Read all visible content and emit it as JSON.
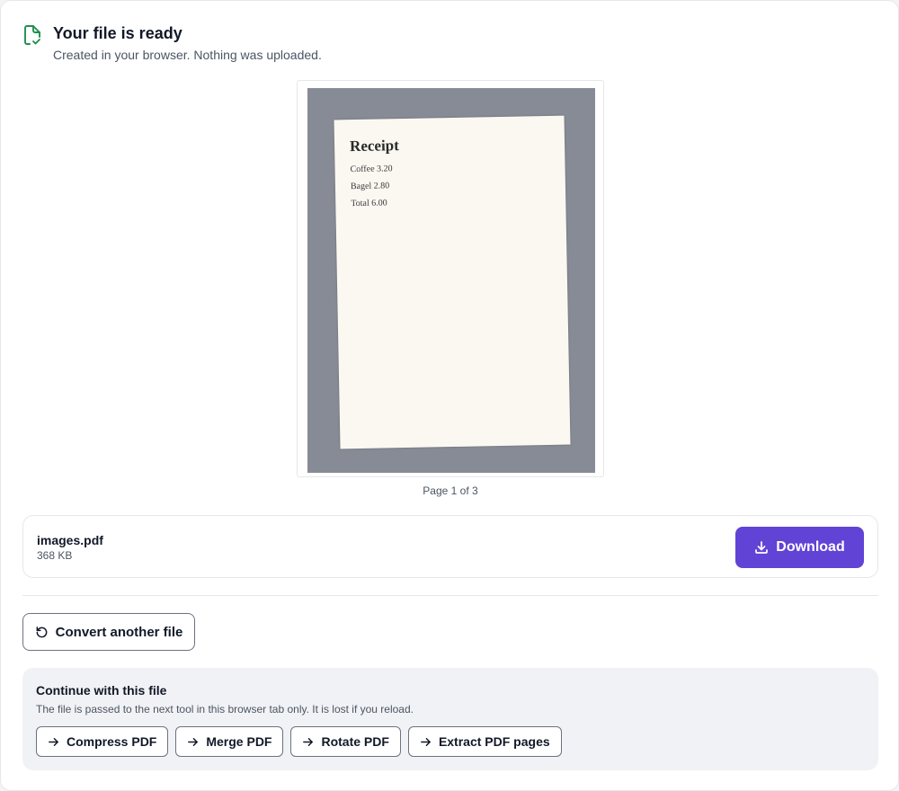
{
  "header": {
    "icon": "file-check-icon",
    "title": "Your file is ready",
    "subtitle": "Created in your browser. Nothing was uploaded."
  },
  "preview": {
    "document_title": "Receipt",
    "document_lines": [
      "Coffee 3.20",
      "Bagel 2.80",
      "Total 6.00"
    ],
    "page_indicator": "Page 1 of 3"
  },
  "file": {
    "name": "images.pdf",
    "size": "368 KB",
    "download_label": "Download",
    "download_icon": "download-icon"
  },
  "actions": {
    "convert_another_label": "Convert another file",
    "convert_another_icon": "rotate-ccw-icon"
  },
  "continue": {
    "title": "Continue with this file",
    "note": "The file is passed to the next tool in this browser tab only. It is lost if you reload.",
    "tools": [
      {
        "label": "Compress PDF",
        "icon": "arrow-right-icon"
      },
      {
        "label": "Merge PDF",
        "icon": "arrow-right-icon"
      },
      {
        "label": "Rotate PDF",
        "icon": "arrow-right-icon"
      },
      {
        "label": "Extract PDF pages",
        "icon": "arrow-right-icon"
      }
    ]
  },
  "colors": {
    "accent": "#6143d6",
    "success": "#1f8f4e",
    "preview_background": "#878b95",
    "panel_background": "#f1f2f5"
  }
}
